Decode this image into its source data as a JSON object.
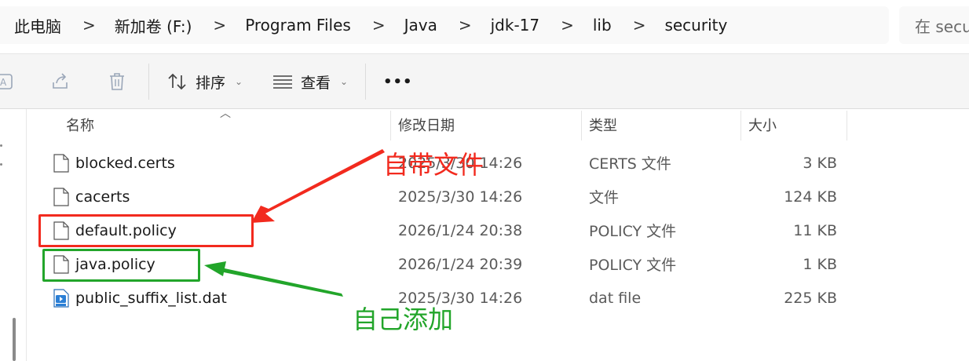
{
  "breadcrumb": [
    "此电脑",
    "新加卷 (F:)",
    "Program Files",
    "Java",
    "jdk-17",
    "lib",
    "security"
  ],
  "breadcrumb_separator": ">",
  "search": {
    "placeholder": "在 security 中搜索"
  },
  "toolbar": {
    "sort_label": "排序",
    "view_label": "查看",
    "more_label": "•••"
  },
  "columns": {
    "name": "名称",
    "date": "修改日期",
    "type": "类型",
    "size": "大小"
  },
  "files": [
    {
      "name": "blocked.certs",
      "date": "2025/3/30 14:26",
      "type": "CERTS 文件",
      "size": "3 KB",
      "icon": "document-icon"
    },
    {
      "name": "cacerts",
      "date": "2025/3/30 14:26",
      "type": "文件",
      "size": "124 KB",
      "icon": "document-icon"
    },
    {
      "name": "default.policy",
      "date": "2026/1/24 20:38",
      "type": "POLICY 文件",
      "size": "11 KB",
      "icon": "document-icon"
    },
    {
      "name": "java.policy",
      "date": "2026/1/24 20:39",
      "type": "POLICY 文件",
      "size": "1 KB",
      "icon": "document-icon"
    },
    {
      "name": "public_suffix_list.dat",
      "date": "2025/3/30 14:26",
      "type": "dat file",
      "size": "225 KB",
      "icon": "video-file-icon"
    }
  ],
  "annotations": {
    "builtin_label": "自带文件",
    "added_label": "自己添加",
    "builtin_color": "#f22a1e",
    "added_color": "#22a52a"
  }
}
